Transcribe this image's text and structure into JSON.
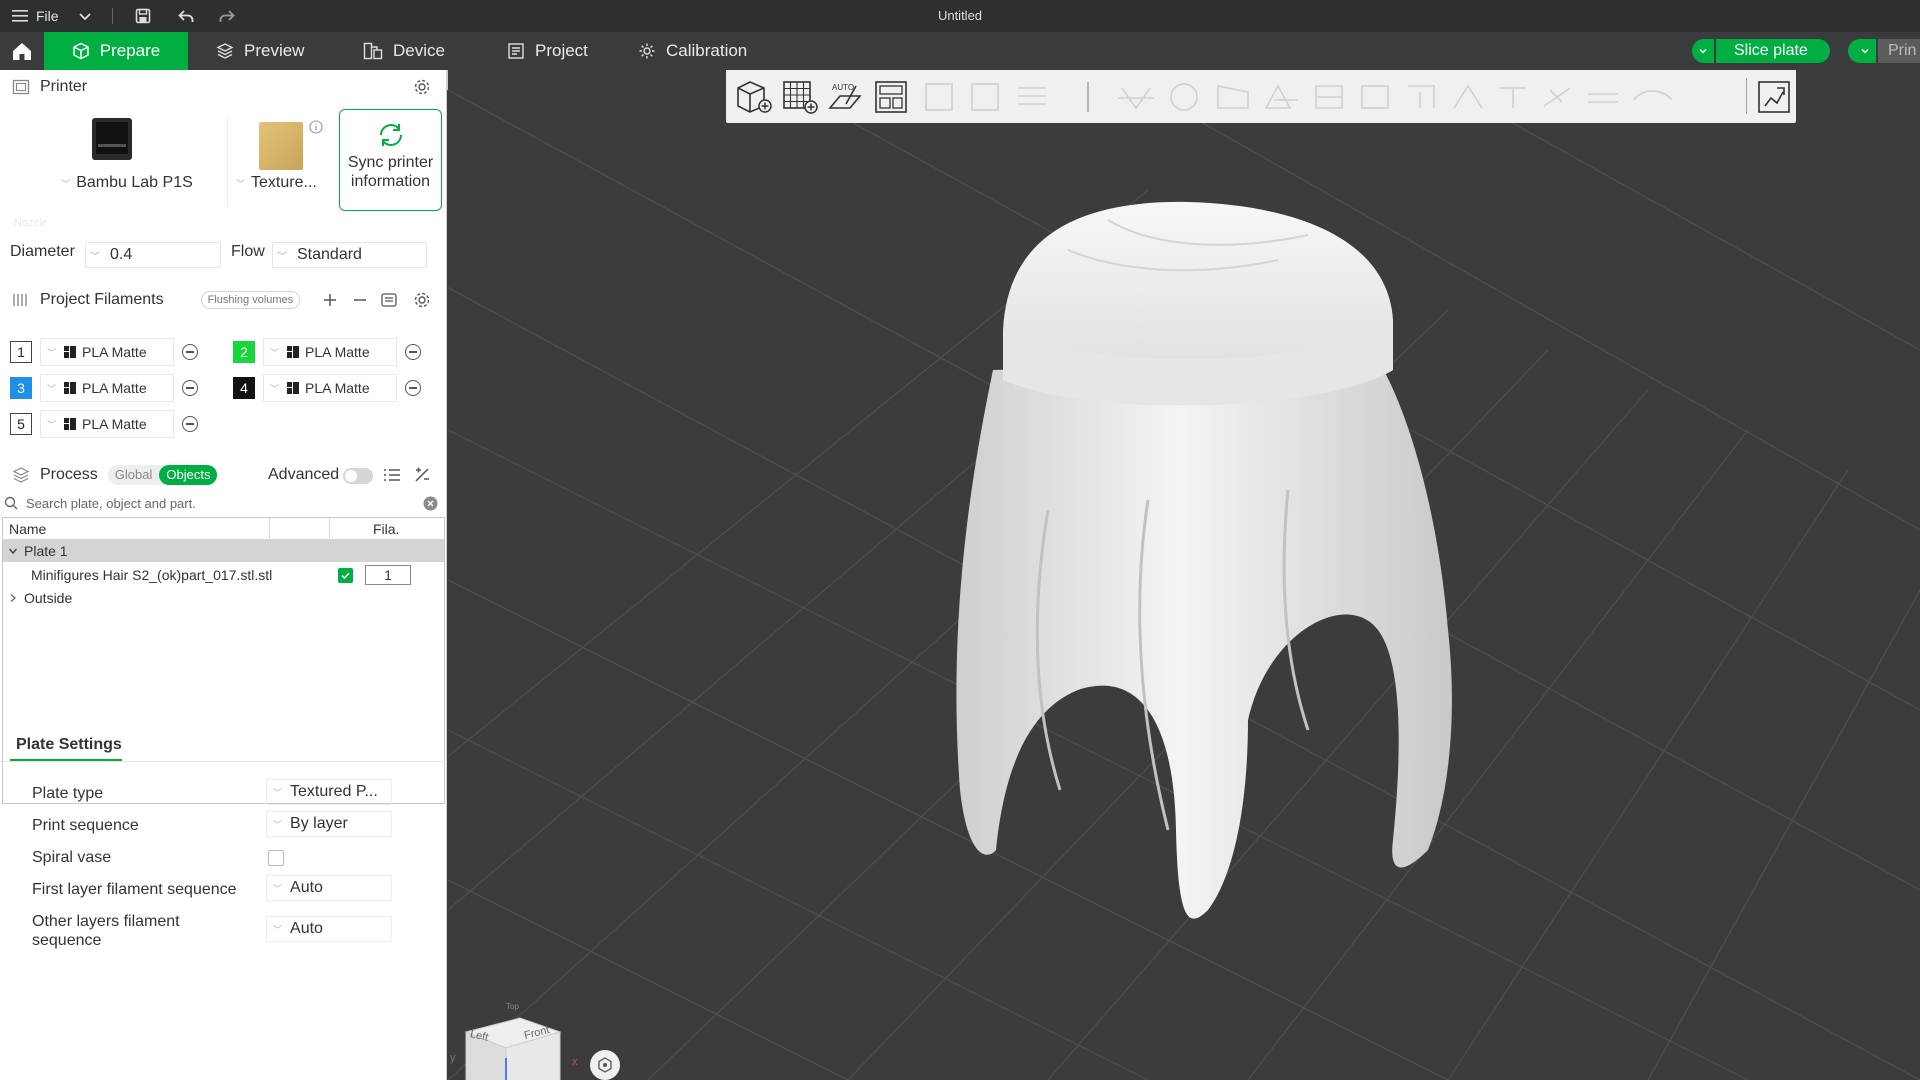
{
  "titlebar": {
    "file_label": "File",
    "title": "Untitled"
  },
  "tabs": [
    {
      "label": "Prepare",
      "active": true
    },
    {
      "label": "Preview"
    },
    {
      "label": "Device"
    },
    {
      "label": "Project"
    },
    {
      "label": "Calibration"
    }
  ],
  "actions": {
    "slice_label": "Slice plate",
    "print_label": "Prin"
  },
  "printer": {
    "section_title": "Printer",
    "printer_name": "Bambu Lab P1S",
    "plate_name": "Texture...",
    "sync_label_1": "Sync printer",
    "sync_label_2": "information",
    "nozzle_label": "Nozzle",
    "diameter_label": "Diameter",
    "diameter_value": "0.4",
    "flow_label": "Flow",
    "flow_value": "Standard"
  },
  "filaments": {
    "section_title": "Project Filaments",
    "flushing_label": "Flushing volumes",
    "items": [
      {
        "num": "1",
        "name": "PLA Matte",
        "color": "#ffffff",
        "text": "#222222"
      },
      {
        "num": "2",
        "name": "PLA Matte",
        "color": "#17d63a",
        "text": "#ffffff"
      },
      {
        "num": "3",
        "name": "PLA Matte",
        "color": "#1e90e8",
        "text": "#ffffff"
      },
      {
        "num": "4",
        "name": "PLA Matte",
        "color": "#111111",
        "text": "#ffffff"
      },
      {
        "num": "5",
        "name": "PLA Matte",
        "color": "#ffffff",
        "text": "#222222"
      }
    ]
  },
  "process": {
    "section_title": "Process",
    "global_label": "Global",
    "objects_label": "Objects",
    "advanced_label": "Advanced"
  },
  "search": {
    "placeholder": "Search plate, object and part."
  },
  "tree": {
    "col_name": "Name",
    "col_fila": "Fila.",
    "plate_label": "Plate 1",
    "object_name": "Minifigures Hair S2_(ok)part_017.stl.stl",
    "object_fila": "1",
    "outside_label": "Outside"
  },
  "plate_settings": {
    "tab_label": "Plate Settings",
    "plate_type_label": "Plate type",
    "plate_type_value": "Textured P...",
    "print_sequence_label": "Print sequence",
    "print_sequence_value": "By layer",
    "spiral_label": "Spiral vase",
    "first_layer_label": "First layer filament sequence",
    "first_layer_value": "Auto",
    "other_layers_label_1": "Other layers filament",
    "other_layers_label_2": "sequence",
    "other_layers_value": "Auto"
  },
  "view_cube": {
    "top": "Top",
    "left": "Left",
    "front": "Front",
    "axis_y": "y",
    "axis_x": "x"
  },
  "colors": {
    "accent": "#00ae42",
    "viewport_bg": "#3c3c3c"
  }
}
